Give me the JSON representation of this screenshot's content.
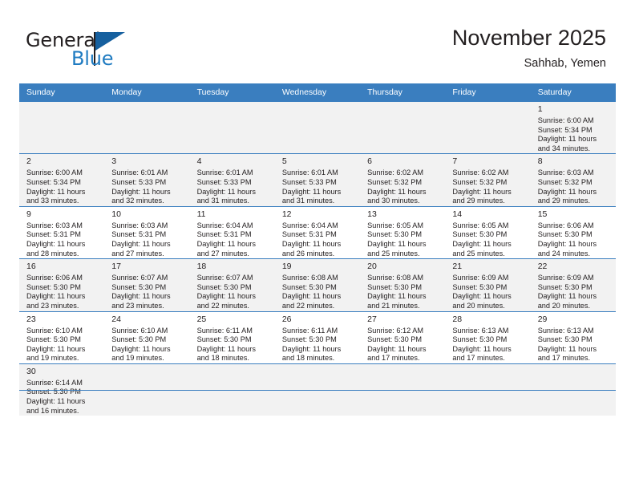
{
  "brand": {
    "name_part1": "General",
    "name_part2": "Blue",
    "logo_icon": "blue-flag-logo"
  },
  "header": {
    "month_title": "November 2025",
    "location": "Sahhab, Yemen"
  },
  "calendar": {
    "weekday_headers": [
      "Sunday",
      "Monday",
      "Tuesday",
      "Wednesday",
      "Thursday",
      "Friday",
      "Saturday"
    ],
    "header_bg": "#3a7ebf",
    "shaded_row_bg": "#f2f2f2",
    "grid_line": "#3a7ebf",
    "weeks": [
      {
        "shaded": true,
        "days": [
          {
            "num": "",
            "info": "",
            "empty": true
          },
          {
            "num": "",
            "info": "",
            "empty": true
          },
          {
            "num": "",
            "info": "",
            "empty": true
          },
          {
            "num": "",
            "info": "",
            "empty": true
          },
          {
            "num": "",
            "info": "",
            "empty": true
          },
          {
            "num": "",
            "info": "",
            "empty": true
          },
          {
            "num": "1",
            "info": "Sunrise: 6:00 AM\nSunset: 5:34 PM\nDaylight: 11 hours\nand 34 minutes."
          }
        ]
      },
      {
        "shaded": true,
        "days": [
          {
            "num": "2",
            "info": "Sunrise: 6:00 AM\nSunset: 5:34 PM\nDaylight: 11 hours\nand 33 minutes."
          },
          {
            "num": "3",
            "info": "Sunrise: 6:01 AM\nSunset: 5:33 PM\nDaylight: 11 hours\nand 32 minutes."
          },
          {
            "num": "4",
            "info": "Sunrise: 6:01 AM\nSunset: 5:33 PM\nDaylight: 11 hours\nand 31 minutes."
          },
          {
            "num": "5",
            "info": "Sunrise: 6:01 AM\nSunset: 5:33 PM\nDaylight: 11 hours\nand 31 minutes."
          },
          {
            "num": "6",
            "info": "Sunrise: 6:02 AM\nSunset: 5:32 PM\nDaylight: 11 hours\nand 30 minutes."
          },
          {
            "num": "7",
            "info": "Sunrise: 6:02 AM\nSunset: 5:32 PM\nDaylight: 11 hours\nand 29 minutes."
          },
          {
            "num": "8",
            "info": "Sunrise: 6:03 AM\nSunset: 5:32 PM\nDaylight: 11 hours\nand 29 minutes."
          }
        ]
      },
      {
        "shaded": false,
        "days": [
          {
            "num": "9",
            "info": "Sunrise: 6:03 AM\nSunset: 5:31 PM\nDaylight: 11 hours\nand 28 minutes."
          },
          {
            "num": "10",
            "info": "Sunrise: 6:03 AM\nSunset: 5:31 PM\nDaylight: 11 hours\nand 27 minutes."
          },
          {
            "num": "11",
            "info": "Sunrise: 6:04 AM\nSunset: 5:31 PM\nDaylight: 11 hours\nand 27 minutes."
          },
          {
            "num": "12",
            "info": "Sunrise: 6:04 AM\nSunset: 5:31 PM\nDaylight: 11 hours\nand 26 minutes."
          },
          {
            "num": "13",
            "info": "Sunrise: 6:05 AM\nSunset: 5:30 PM\nDaylight: 11 hours\nand 25 minutes."
          },
          {
            "num": "14",
            "info": "Sunrise: 6:05 AM\nSunset: 5:30 PM\nDaylight: 11 hours\nand 25 minutes."
          },
          {
            "num": "15",
            "info": "Sunrise: 6:06 AM\nSunset: 5:30 PM\nDaylight: 11 hours\nand 24 minutes."
          }
        ]
      },
      {
        "shaded": true,
        "days": [
          {
            "num": "16",
            "info": "Sunrise: 6:06 AM\nSunset: 5:30 PM\nDaylight: 11 hours\nand 23 minutes."
          },
          {
            "num": "17",
            "info": "Sunrise: 6:07 AM\nSunset: 5:30 PM\nDaylight: 11 hours\nand 23 minutes."
          },
          {
            "num": "18",
            "info": "Sunrise: 6:07 AM\nSunset: 5:30 PM\nDaylight: 11 hours\nand 22 minutes."
          },
          {
            "num": "19",
            "info": "Sunrise: 6:08 AM\nSunset: 5:30 PM\nDaylight: 11 hours\nand 22 minutes."
          },
          {
            "num": "20",
            "info": "Sunrise: 6:08 AM\nSunset: 5:30 PM\nDaylight: 11 hours\nand 21 minutes."
          },
          {
            "num": "21",
            "info": "Sunrise: 6:09 AM\nSunset: 5:30 PM\nDaylight: 11 hours\nand 20 minutes."
          },
          {
            "num": "22",
            "info": "Sunrise: 6:09 AM\nSunset: 5:30 PM\nDaylight: 11 hours\nand 20 minutes."
          }
        ]
      },
      {
        "shaded": false,
        "days": [
          {
            "num": "23",
            "info": "Sunrise: 6:10 AM\nSunset: 5:30 PM\nDaylight: 11 hours\nand 19 minutes."
          },
          {
            "num": "24",
            "info": "Sunrise: 6:10 AM\nSunset: 5:30 PM\nDaylight: 11 hours\nand 19 minutes."
          },
          {
            "num": "25",
            "info": "Sunrise: 6:11 AM\nSunset: 5:30 PM\nDaylight: 11 hours\nand 18 minutes."
          },
          {
            "num": "26",
            "info": "Sunrise: 6:11 AM\nSunset: 5:30 PM\nDaylight: 11 hours\nand 18 minutes."
          },
          {
            "num": "27",
            "info": "Sunrise: 6:12 AM\nSunset: 5:30 PM\nDaylight: 11 hours\nand 17 minutes."
          },
          {
            "num": "28",
            "info": "Sunrise: 6:13 AM\nSunset: 5:30 PM\nDaylight: 11 hours\nand 17 minutes."
          },
          {
            "num": "29",
            "info": "Sunrise: 6:13 AM\nSunset: 5:30 PM\nDaylight: 11 hours\nand 17 minutes."
          }
        ]
      },
      {
        "shaded": true,
        "days": [
          {
            "num": "30",
            "info": "Sunrise: 6:14 AM\nSunset: 5:30 PM\nDaylight: 11 hours\nand 16 minutes."
          },
          {
            "num": "",
            "info": "",
            "empty": true
          },
          {
            "num": "",
            "info": "",
            "empty": true
          },
          {
            "num": "",
            "info": "",
            "empty": true
          },
          {
            "num": "",
            "info": "",
            "empty": true
          },
          {
            "num": "",
            "info": "",
            "empty": true
          },
          {
            "num": "",
            "info": "",
            "empty": true
          }
        ]
      }
    ]
  }
}
